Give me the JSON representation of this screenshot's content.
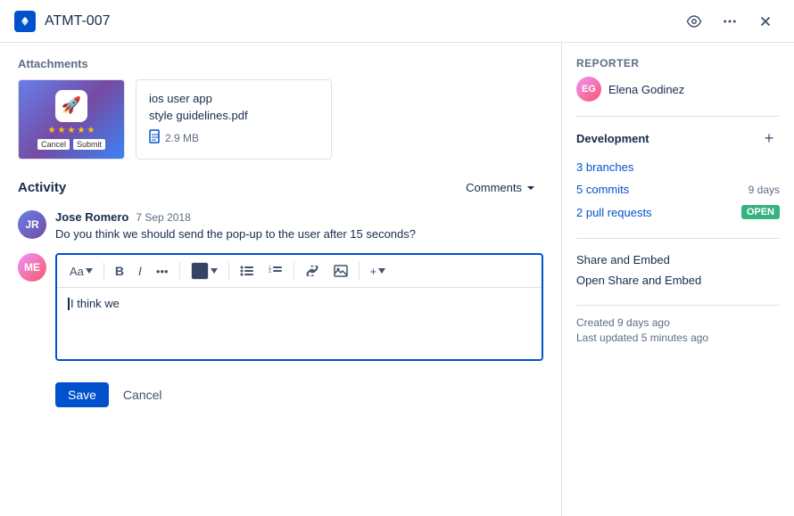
{
  "header": {
    "title": "ATMT-007",
    "logo_alt": "Jira-like logo"
  },
  "attachments": {
    "section_label": "Attachments",
    "file": {
      "name": "ios user app\nstyle guidelines.pdf",
      "size": "2.9 MB"
    }
  },
  "activity": {
    "section_label": "Activity",
    "comments_label": "Comments",
    "comment": {
      "author": "Jose Romero",
      "date": "7 Sep 2018",
      "text": "Do you think we should send the pop-up to the user after 15 seconds?"
    }
  },
  "editor": {
    "content": "I think we",
    "toolbar": {
      "text_style": "Aa",
      "bold": "B",
      "italic": "I",
      "more": "•••",
      "bullet_list": "≡",
      "numbered_list": "≡",
      "link": "🔗",
      "image": "🖼",
      "add": "+"
    }
  },
  "buttons": {
    "save": "Save",
    "cancel": "Cancel"
  },
  "sidebar": {
    "reporter_label": "Reporter",
    "reporter_name": "Elena Godinez",
    "development_label": "Development",
    "branches": "3 branches",
    "commits": "5 commits",
    "commits_days": "9 days",
    "pull_requests": "2 pull requests",
    "pull_requests_badge": "OPEN",
    "share_embed": "Share and Embed",
    "open_share_embed": "Open Share and Embed",
    "created": "Created 9 days ago",
    "last_updated": "Last updated 5 minutes ago"
  }
}
